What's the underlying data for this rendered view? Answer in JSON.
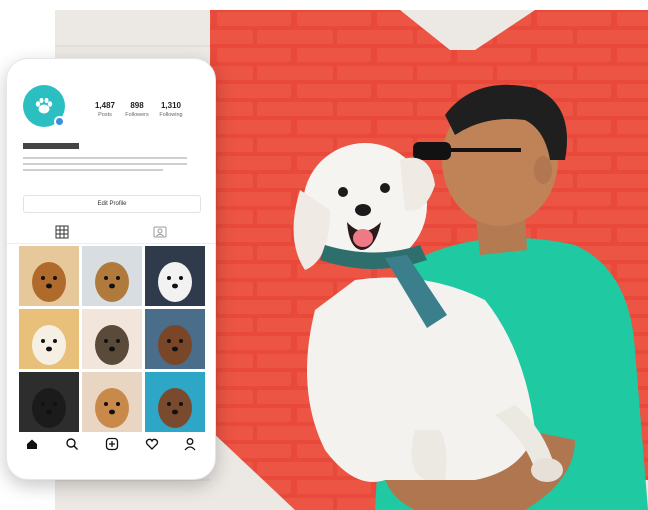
{
  "profile": {
    "avatar_icon": "paw-icon",
    "stats": [
      {
        "value": "1,487",
        "label": "Posts"
      },
      {
        "value": "898",
        "label": "Followers"
      },
      {
        "value": "1,310",
        "label": "Following"
      }
    ],
    "edit_profile_label": "Edit Profile"
  },
  "tabs": [
    {
      "icon": "grid-icon"
    },
    {
      "icon": "tagged-icon"
    }
  ],
  "grid": {
    "tiles": [
      {
        "colors": [
          "#e7c89a",
          "#b06a2c"
        ]
      },
      {
        "colors": [
          "#d8dde2",
          "#b07a3c"
        ]
      },
      {
        "colors": [
          "#2f3a4a",
          "#f2f2f2"
        ]
      },
      {
        "colors": [
          "#e9c07a",
          "#f6f0e4"
        ]
      },
      {
        "colors": [
          "#f2e6dc",
          "#5a4a3a"
        ]
      },
      {
        "colors": [
          "#4a6d8a",
          "#7a4628"
        ]
      },
      {
        "colors": [
          "#2d2d2d",
          "#1b1b1b"
        ]
      },
      {
        "colors": [
          "#e9d6c2",
          "#c9894a"
        ]
      },
      {
        "colors": [
          "#2ea7c7",
          "#7a4a2e"
        ]
      }
    ]
  },
  "bottom_nav": [
    {
      "icon": "home-icon"
    },
    {
      "icon": "search-icon"
    },
    {
      "icon": "add-post-icon"
    },
    {
      "icon": "heart-icon"
    },
    {
      "icon": "profile-icon"
    }
  ],
  "colors": {
    "brand_teal": "#2bbfc1",
    "wall_red": "#e84a3a",
    "shirt_green": "#1fc9a1"
  }
}
